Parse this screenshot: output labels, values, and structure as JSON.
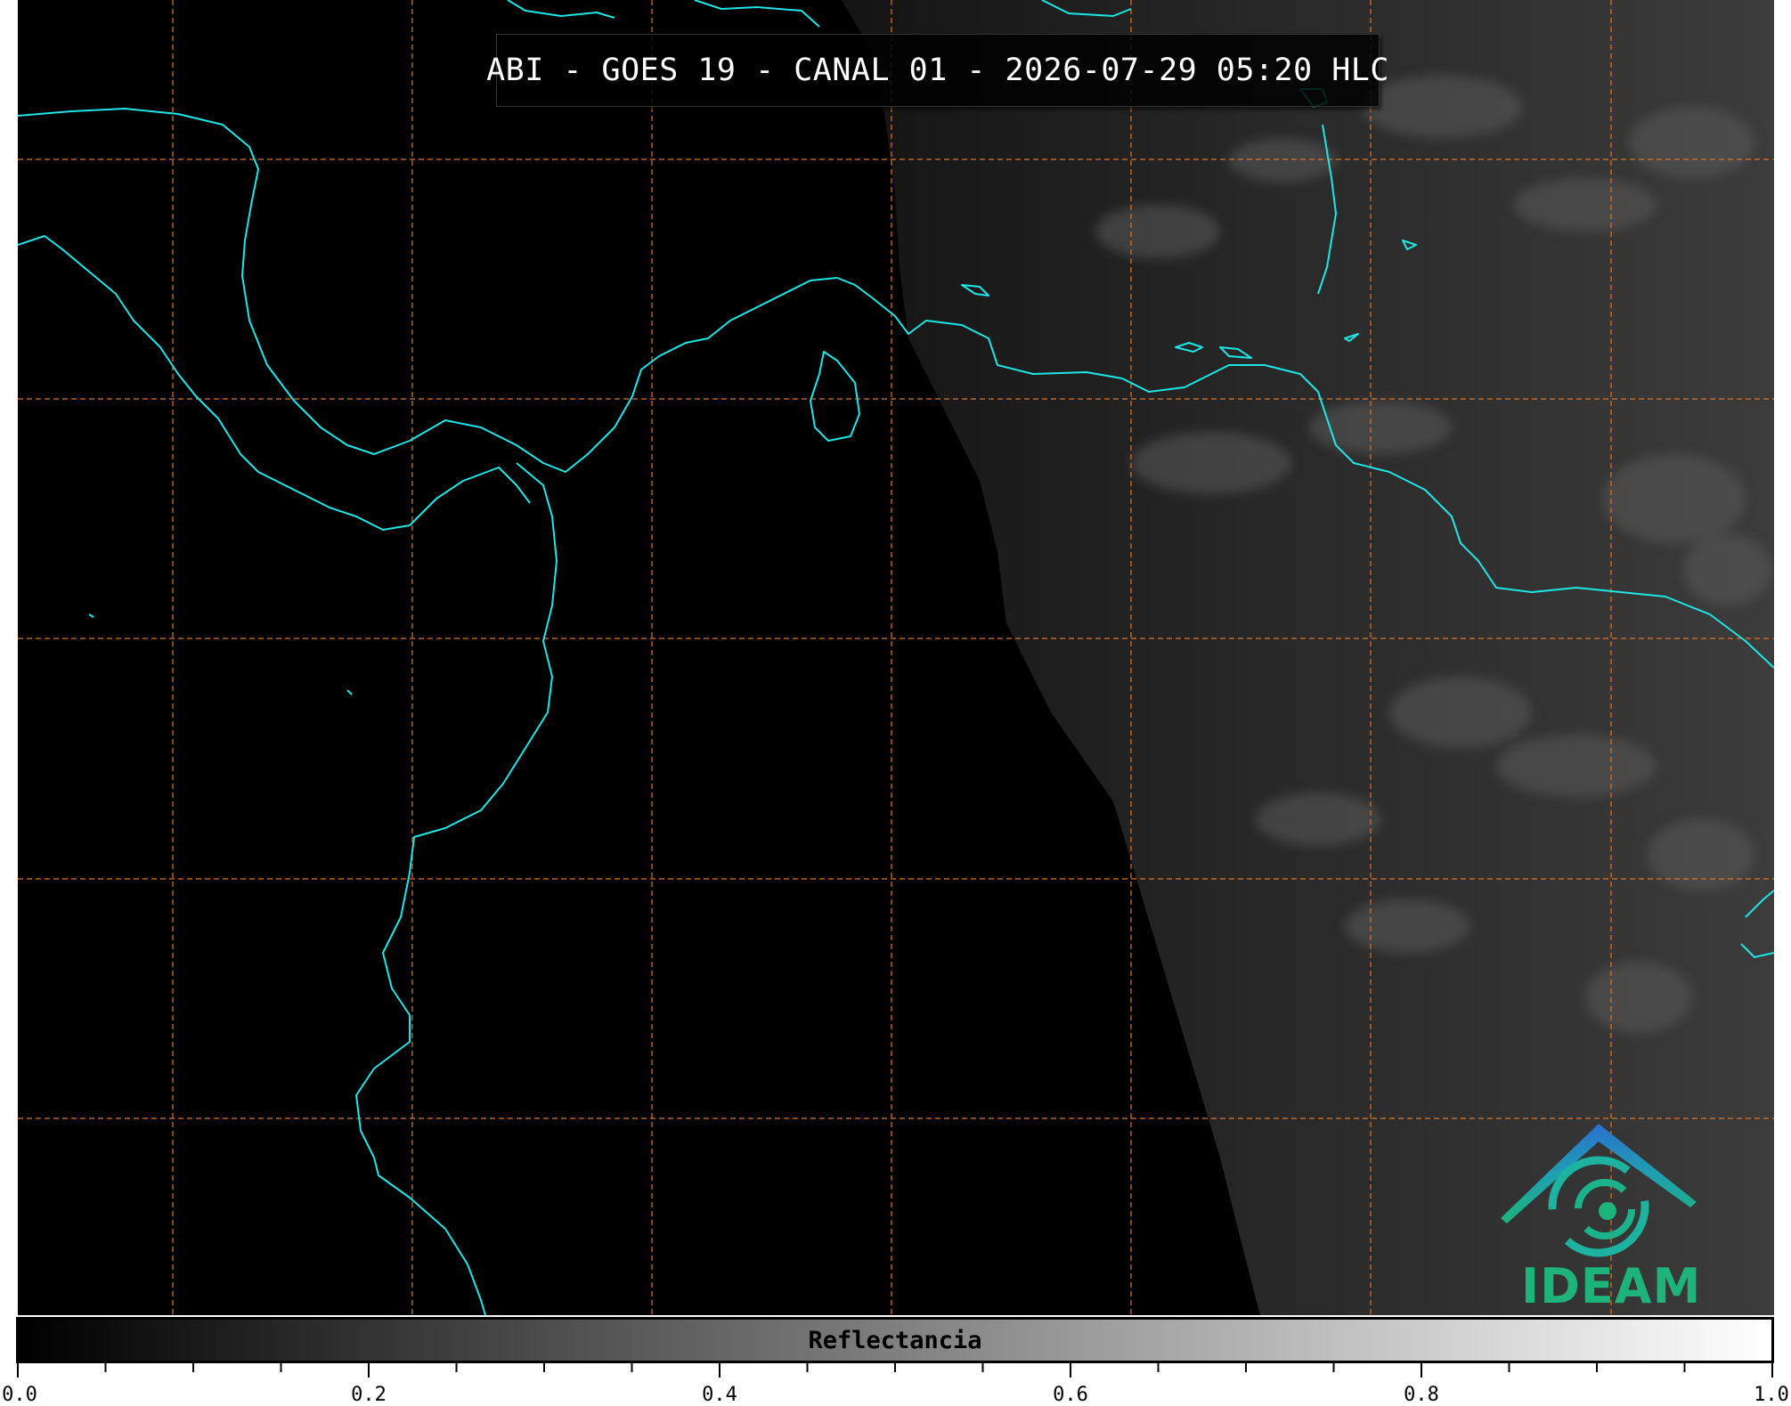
{
  "title": "ABI - GOES 19 - CANAL 01 - 2026-07-29 05:20 HLC",
  "logo": {
    "text": "IDEAM"
  },
  "colorbar": {
    "label": "Reflectancia",
    "min": 0.0,
    "max": 1.0,
    "tick_labels": [
      "0.0",
      "0.2",
      "0.4",
      "0.6",
      "0.8",
      "1.0"
    ],
    "colormap": [
      "#000000",
      "#ffffff"
    ]
  },
  "style": {
    "coastline_color": "#1ee6e6",
    "grid_color": "#d9772b",
    "logo_color": "#1db37a",
    "logo_roof_color": "#2c6fd1"
  }
}
